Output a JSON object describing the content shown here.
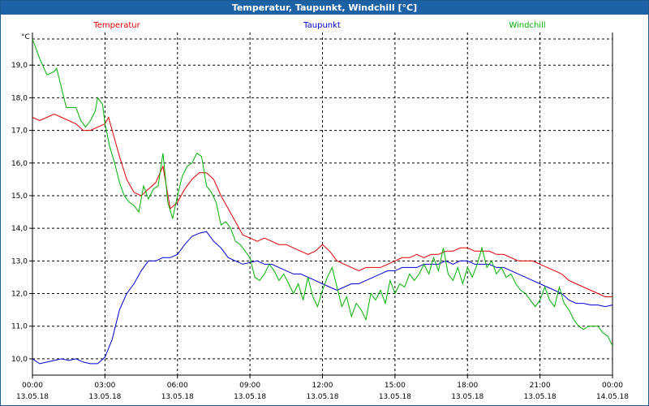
{
  "window": {
    "title": "Temperatur, Taupunkt, Windchill [°C]"
  },
  "colors": {
    "titlebar": "#1e62a6",
    "grid": "#000000",
    "background": "#ffffff"
  },
  "chart_data": {
    "type": "line",
    "title": "Temperatur, Taupunkt, Windchill [°C]",
    "ylabel": "°C",
    "ylim": [
      9.5,
      20.0
    ],
    "xlim_hours": [
      0,
      24
    ],
    "grid": true,
    "legend_placement": "top",
    "y_ticks": [
      "10,0",
      "11,0",
      "12,0",
      "13,0",
      "14,0",
      "15,0",
      "16,0",
      "17,0",
      "18,0",
      "19,0"
    ],
    "x_ticks": [
      {
        "time": "00:00",
        "date": "13.05.18"
      },
      {
        "time": "03:00",
        "date": "13.05.18"
      },
      {
        "time": "06:00",
        "date": "13.05.18"
      },
      {
        "time": "09:00",
        "date": "13.05.18"
      },
      {
        "time": "12:00",
        "date": "13.05.18"
      },
      {
        "time": "15:00",
        "date": "13.05.18"
      },
      {
        "time": "18:00",
        "date": "13.05.18"
      },
      {
        "time": "21:00",
        "date": "13.05.18"
      },
      {
        "time": "00:00",
        "date": "14.05.18"
      }
    ],
    "series": [
      {
        "name": "Temperatur",
        "color": "#e00000",
        "points": [
          [
            0,
            17.4
          ],
          [
            0.3,
            17.3
          ],
          [
            0.6,
            17.4
          ],
          [
            0.9,
            17.5
          ],
          [
            1.2,
            17.4
          ],
          [
            1.5,
            17.3
          ],
          [
            1.8,
            17.2
          ],
          [
            2.1,
            17.0
          ],
          [
            2.4,
            17.0
          ],
          [
            2.7,
            17.1
          ],
          [
            3.0,
            17.2
          ],
          [
            3.15,
            17.4
          ],
          [
            3.3,
            17.0
          ],
          [
            3.6,
            16.2
          ],
          [
            3.9,
            15.5
          ],
          [
            4.2,
            15.1
          ],
          [
            4.5,
            15.0
          ],
          [
            4.8,
            15.2
          ],
          [
            5.1,
            15.4
          ],
          [
            5.4,
            15.9
          ],
          [
            5.7,
            14.6
          ],
          [
            6.0,
            14.8
          ],
          [
            6.3,
            15.2
          ],
          [
            6.6,
            15.5
          ],
          [
            6.9,
            15.7
          ],
          [
            7.2,
            15.7
          ],
          [
            7.5,
            15.5
          ],
          [
            7.8,
            15.0
          ],
          [
            8.1,
            14.6
          ],
          [
            8.4,
            14.2
          ],
          [
            8.7,
            13.8
          ],
          [
            9.0,
            13.7
          ],
          [
            9.3,
            13.6
          ],
          [
            9.6,
            13.7
          ],
          [
            9.9,
            13.6
          ],
          [
            10.2,
            13.5
          ],
          [
            10.5,
            13.5
          ],
          [
            10.8,
            13.4
          ],
          [
            11.1,
            13.3
          ],
          [
            11.4,
            13.2
          ],
          [
            11.7,
            13.3
          ],
          [
            12.0,
            13.5
          ],
          [
            12.3,
            13.3
          ],
          [
            12.6,
            13.0
          ],
          [
            12.9,
            12.9
          ],
          [
            13.2,
            12.8
          ],
          [
            13.5,
            12.7
          ],
          [
            13.8,
            12.8
          ],
          [
            14.1,
            12.8
          ],
          [
            14.4,
            12.8
          ],
          [
            14.7,
            12.9
          ],
          [
            15.0,
            13.0
          ],
          [
            15.3,
            13.1
          ],
          [
            15.6,
            13.1
          ],
          [
            15.9,
            13.2
          ],
          [
            16.2,
            13.1
          ],
          [
            16.5,
            13.2
          ],
          [
            16.8,
            13.2
          ],
          [
            17.1,
            13.3
          ],
          [
            17.4,
            13.3
          ],
          [
            17.7,
            13.4
          ],
          [
            18.0,
            13.4
          ],
          [
            18.3,
            13.3
          ],
          [
            18.6,
            13.3
          ],
          [
            18.9,
            13.3
          ],
          [
            19.2,
            13.2
          ],
          [
            19.5,
            13.2
          ],
          [
            19.8,
            13.1
          ],
          [
            20.1,
            13.0
          ],
          [
            20.4,
            13.0
          ],
          [
            20.7,
            13.0
          ],
          [
            21.0,
            12.9
          ],
          [
            21.3,
            12.8
          ],
          [
            21.6,
            12.7
          ],
          [
            21.9,
            12.6
          ],
          [
            22.2,
            12.4
          ],
          [
            22.5,
            12.3
          ],
          [
            22.8,
            12.2
          ],
          [
            23.1,
            12.1
          ],
          [
            23.4,
            12.0
          ],
          [
            23.7,
            11.9
          ],
          [
            24.0,
            11.9
          ]
        ]
      },
      {
        "name": "Taupunkt",
        "color": "#0000d0",
        "points": [
          [
            0,
            10.0
          ],
          [
            0.3,
            9.85
          ],
          [
            0.6,
            9.9
          ],
          [
            0.9,
            9.95
          ],
          [
            1.2,
            10.0
          ],
          [
            1.5,
            9.95
          ],
          [
            1.8,
            10.0
          ],
          [
            2.1,
            9.9
          ],
          [
            2.4,
            9.85
          ],
          [
            2.7,
            9.85
          ],
          [
            3.0,
            10.05
          ],
          [
            3.3,
            10.6
          ],
          [
            3.6,
            11.5
          ],
          [
            3.9,
            12.0
          ],
          [
            4.2,
            12.3
          ],
          [
            4.5,
            12.7
          ],
          [
            4.8,
            13.0
          ],
          [
            5.1,
            13.0
          ],
          [
            5.4,
            13.1
          ],
          [
            5.7,
            13.1
          ],
          [
            6.0,
            13.2
          ],
          [
            6.3,
            13.5
          ],
          [
            6.6,
            13.75
          ],
          [
            6.9,
            13.85
          ],
          [
            7.2,
            13.9
          ],
          [
            7.5,
            13.6
          ],
          [
            7.8,
            13.4
          ],
          [
            8.1,
            13.1
          ],
          [
            8.4,
            13.0
          ],
          [
            8.7,
            12.9
          ],
          [
            9.0,
            12.95
          ],
          [
            9.3,
            13.0
          ],
          [
            9.6,
            12.9
          ],
          [
            9.9,
            12.9
          ],
          [
            10.2,
            12.8
          ],
          [
            10.5,
            12.7
          ],
          [
            10.8,
            12.6
          ],
          [
            11.1,
            12.6
          ],
          [
            11.4,
            12.5
          ],
          [
            11.7,
            12.4
          ],
          [
            12.0,
            12.3
          ],
          [
            12.3,
            12.2
          ],
          [
            12.6,
            12.1
          ],
          [
            12.9,
            12.2
          ],
          [
            13.2,
            12.3
          ],
          [
            13.5,
            12.3
          ],
          [
            13.8,
            12.4
          ],
          [
            14.1,
            12.5
          ],
          [
            14.4,
            12.6
          ],
          [
            14.7,
            12.7
          ],
          [
            15.0,
            12.7
          ],
          [
            15.3,
            12.8
          ],
          [
            15.6,
            12.8
          ],
          [
            15.9,
            12.8
          ],
          [
            16.2,
            12.9
          ],
          [
            16.5,
            12.9
          ],
          [
            16.8,
            12.9
          ],
          [
            17.1,
            13.0
          ],
          [
            17.4,
            12.9
          ],
          [
            17.7,
            13.0
          ],
          [
            18.0,
            13.0
          ],
          [
            18.3,
            12.9
          ],
          [
            18.6,
            12.9
          ],
          [
            18.9,
            12.9
          ],
          [
            19.2,
            12.8
          ],
          [
            19.5,
            12.8
          ],
          [
            19.8,
            12.7
          ],
          [
            20.1,
            12.6
          ],
          [
            20.4,
            12.5
          ],
          [
            20.7,
            12.4
          ],
          [
            21.0,
            12.3
          ],
          [
            21.3,
            12.2
          ],
          [
            21.6,
            12.1
          ],
          [
            21.9,
            12.0
          ],
          [
            22.2,
            11.8
          ],
          [
            22.5,
            11.7
          ],
          [
            22.8,
            11.7
          ],
          [
            23.1,
            11.65
          ],
          [
            23.4,
            11.65
          ],
          [
            23.7,
            11.6
          ],
          [
            24.0,
            11.65
          ]
        ]
      },
      {
        "name": "Windchill",
        "color": "#00b000",
        "points": [
          [
            0,
            19.8
          ],
          [
            0.3,
            19.2
          ],
          [
            0.6,
            18.7
          ],
          [
            0.9,
            18.8
          ],
          [
            1.0,
            18.9
          ],
          [
            1.2,
            18.3
          ],
          [
            1.4,
            17.7
          ],
          [
            1.8,
            17.7
          ],
          [
            2.0,
            17.3
          ],
          [
            2.2,
            17.1
          ],
          [
            2.4,
            17.3
          ],
          [
            2.6,
            17.6
          ],
          [
            2.7,
            18.0
          ],
          [
            2.9,
            17.8
          ],
          [
            3.0,
            17.2
          ],
          [
            3.2,
            16.5
          ],
          [
            3.4,
            16.0
          ],
          [
            3.6,
            15.4
          ],
          [
            3.8,
            15.0
          ],
          [
            4.0,
            14.8
          ],
          [
            4.2,
            14.7
          ],
          [
            4.4,
            14.5
          ],
          [
            4.6,
            15.3
          ],
          [
            4.8,
            14.9
          ],
          [
            5.0,
            15.2
          ],
          [
            5.2,
            15.3
          ],
          [
            5.4,
            16.3
          ],
          [
            5.6,
            14.8
          ],
          [
            5.8,
            14.3
          ],
          [
            6.0,
            15.0
          ],
          [
            6.2,
            15.6
          ],
          [
            6.4,
            15.9
          ],
          [
            6.6,
            16.0
          ],
          [
            6.8,
            16.3
          ],
          [
            7.0,
            16.2
          ],
          [
            7.2,
            15.3
          ],
          [
            7.4,
            15.1
          ],
          [
            7.6,
            14.8
          ],
          [
            7.8,
            14.1
          ],
          [
            8.0,
            14.2
          ],
          [
            8.2,
            14.0
          ],
          [
            8.4,
            13.6
          ],
          [
            8.6,
            13.5
          ],
          [
            8.8,
            13.3
          ],
          [
            9.0,
            13.1
          ],
          [
            9.2,
            12.5
          ],
          [
            9.4,
            12.4
          ],
          [
            9.6,
            12.6
          ],
          [
            9.8,
            12.9
          ],
          [
            10.0,
            12.7
          ],
          [
            10.2,
            12.4
          ],
          [
            10.4,
            12.6
          ],
          [
            10.6,
            12.3
          ],
          [
            10.8,
            12.0
          ],
          [
            11.0,
            12.3
          ],
          [
            11.2,
            11.8
          ],
          [
            11.4,
            12.5
          ],
          [
            11.6,
            11.9
          ],
          [
            11.8,
            11.6
          ],
          [
            12.0,
            12.1
          ],
          [
            12.2,
            12.5
          ],
          [
            12.4,
            12.8
          ],
          [
            12.6,
            12.2
          ],
          [
            12.8,
            11.6
          ],
          [
            13.0,
            11.9
          ],
          [
            13.2,
            11.3
          ],
          [
            13.4,
            11.7
          ],
          [
            13.6,
            11.5
          ],
          [
            13.8,
            11.2
          ],
          [
            14.0,
            12.0
          ],
          [
            14.2,
            11.8
          ],
          [
            14.4,
            12.1
          ],
          [
            14.6,
            11.7
          ],
          [
            14.8,
            12.4
          ],
          [
            15.0,
            12.0
          ],
          [
            15.2,
            12.3
          ],
          [
            15.4,
            12.2
          ],
          [
            15.6,
            12.6
          ],
          [
            15.8,
            12.4
          ],
          [
            16.0,
            12.6
          ],
          [
            16.2,
            12.9
          ],
          [
            16.4,
            12.6
          ],
          [
            16.6,
            13.1
          ],
          [
            16.8,
            12.7
          ],
          [
            17.0,
            13.4
          ],
          [
            17.2,
            12.6
          ],
          [
            17.4,
            12.4
          ],
          [
            17.6,
            12.8
          ],
          [
            17.8,
            12.3
          ],
          [
            18.0,
            12.8
          ],
          [
            18.2,
            12.5
          ],
          [
            18.4,
            12.9
          ],
          [
            18.6,
            13.4
          ],
          [
            18.8,
            12.8
          ],
          [
            19.0,
            13.0
          ],
          [
            19.2,
            12.6
          ],
          [
            19.4,
            12.8
          ],
          [
            19.6,
            12.5
          ],
          [
            19.8,
            12.6
          ],
          [
            20.0,
            12.3
          ],
          [
            20.2,
            12.1
          ],
          [
            20.4,
            12.0
          ],
          [
            20.6,
            11.8
          ],
          [
            20.8,
            11.6
          ],
          [
            21.0,
            11.8
          ],
          [
            21.2,
            12.2
          ],
          [
            21.4,
            11.8
          ],
          [
            21.6,
            11.6
          ],
          [
            21.8,
            12.2
          ],
          [
            22.0,
            11.7
          ],
          [
            22.2,
            11.5
          ],
          [
            22.4,
            11.2
          ],
          [
            22.6,
            11.0
          ],
          [
            22.8,
            10.9
          ],
          [
            23.0,
            11.0
          ],
          [
            23.2,
            11.0
          ],
          [
            23.4,
            11.0
          ],
          [
            23.6,
            10.8
          ],
          [
            23.8,
            10.7
          ],
          [
            24.0,
            10.4
          ]
        ]
      }
    ]
  }
}
